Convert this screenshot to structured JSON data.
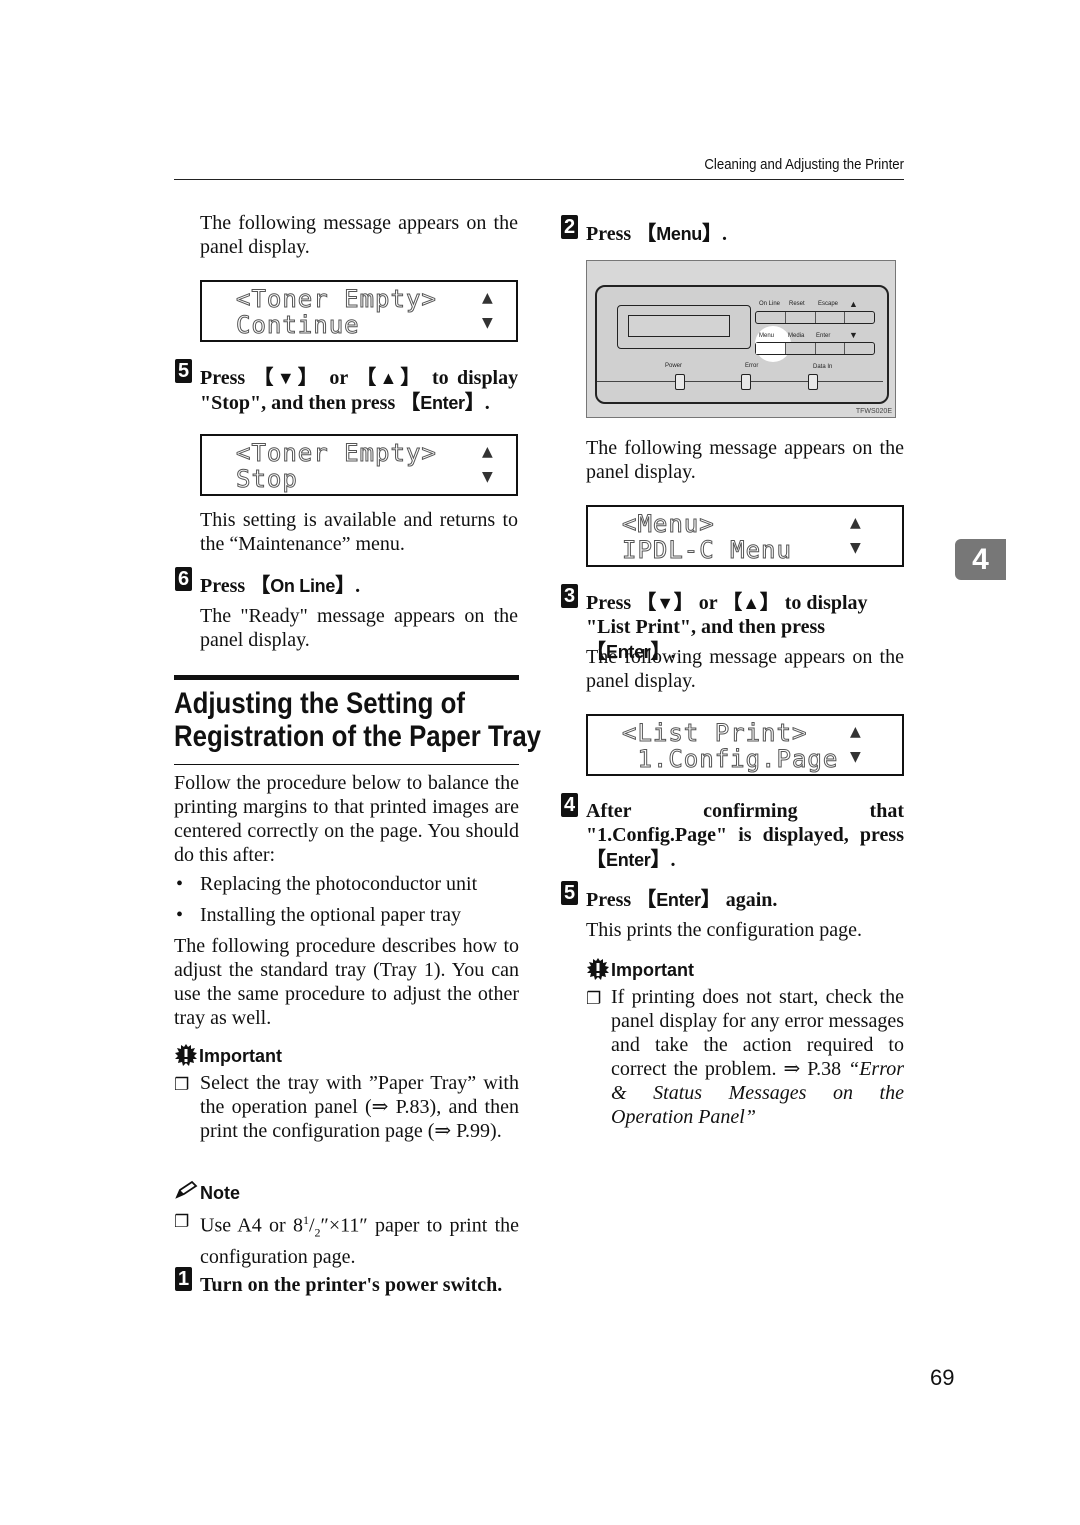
{
  "header": {
    "running_title": "Cleaning and Adjusting the Printer"
  },
  "chapter_tab": "4",
  "page_number": "69",
  "left_column": {
    "intro_text": "The following message appears on the panel display.",
    "lcd_1": {
      "line1": "<Toner Empty>",
      "line2": "Continue",
      "up_arrow": "▲",
      "down_arrow": "▼"
    },
    "step5": {
      "number": "5",
      "text_a": "Press",
      "key_down": "▼",
      "text_or": "or",
      "key_up": "▲",
      "text_b": "to display \"Stop\", and then press",
      "key_enter": "Enter",
      "period": "."
    },
    "lcd_2": {
      "line1": "<Toner Empty>",
      "line2": "Stop",
      "up_arrow": "▲",
      "down_arrow": "▼"
    },
    "step5_note": "This setting is available and returns to the “Maintenance” menu.",
    "step6": {
      "number": "6",
      "text": "Press",
      "key": "On Line",
      "period": "."
    },
    "step6_note": "The \"Ready\" message appears on the panel display.",
    "section_heading_line1": "Adjusting the Setting of",
    "section_heading_line2": "Registration of the Paper Tray",
    "section_intro": "Follow the procedure below to balance the printing margins to that printed images are centered correctly on the page. You should do this after:",
    "bullets": [
      "Replacing the photoconductor unit",
      "Installing the optional paper tray"
    ],
    "procedure_text": "The following procedure describes how to adjust the standard tray (Tray 1). You can use the same procedure to adjust the other tray as well.",
    "important": {
      "title": "Important",
      "item": "Select the tray with ”Paper Tray” with the operation panel (⇒ P.83), and then print the configuration page (⇒ P.99)."
    },
    "note": {
      "title": "Note",
      "item_a": "Use A4 or 8",
      "item_sup": "1",
      "item_slash": "/",
      "item_sub": "2",
      "item_b": "″×11″ paper to print the configuration page."
    },
    "step1": {
      "number": "1",
      "text": "Turn on the printer's power switch."
    }
  },
  "right_column": {
    "step2": {
      "number": "2",
      "text": "Press",
      "key": "Menu",
      "period": "."
    },
    "panel_figure": {
      "labels": {
        "online": "On Line",
        "reset": "Reset",
        "escape": "Escape",
        "up": "▲",
        "menu": "Menu",
        "media": "Media",
        "enter": "Enter",
        "down": "▼",
        "power": "Power",
        "error": "Error",
        "data_in": "Data In"
      },
      "figure_code": "TFWS020E"
    },
    "step2_note": "The following message appears on the panel display.",
    "lcd_3": {
      "line1": "<Menu>",
      "line2": "IPDL-C Menu",
      "up_arrow": "▲",
      "down_arrow": "▼"
    },
    "step3": {
      "number": "3",
      "text_a": "Press",
      "key_down": "▼",
      "text_or": "or",
      "key_up": "▲",
      "text_b": "to display \"List Print\", and then press",
      "key_enter": "Enter",
      "period": "."
    },
    "step3_note": "The following message appears on the panel display.",
    "lcd_4": {
      "line1": "<List Print>",
      "line2": " 1.Config.Page",
      "up_arrow": "▲",
      "down_arrow": "▼"
    },
    "step4": {
      "number": "4",
      "text": "After confirming that \"1.Config.Page\" is displayed, press",
      "key": "Enter",
      "period": "."
    },
    "step5": {
      "number": "5",
      "text_a": "Press",
      "key": "Enter",
      "text_b": "again."
    },
    "step5_note": "This prints the configuration page.",
    "important": {
      "title": "Important",
      "item": "If printing does not start, check the panel display for any error messages and take the action required to correct the problem.",
      "ref_prefix": "⇒ P.38",
      "ref_title": "“Error & Status Messages on the Operation Panel”"
    }
  }
}
